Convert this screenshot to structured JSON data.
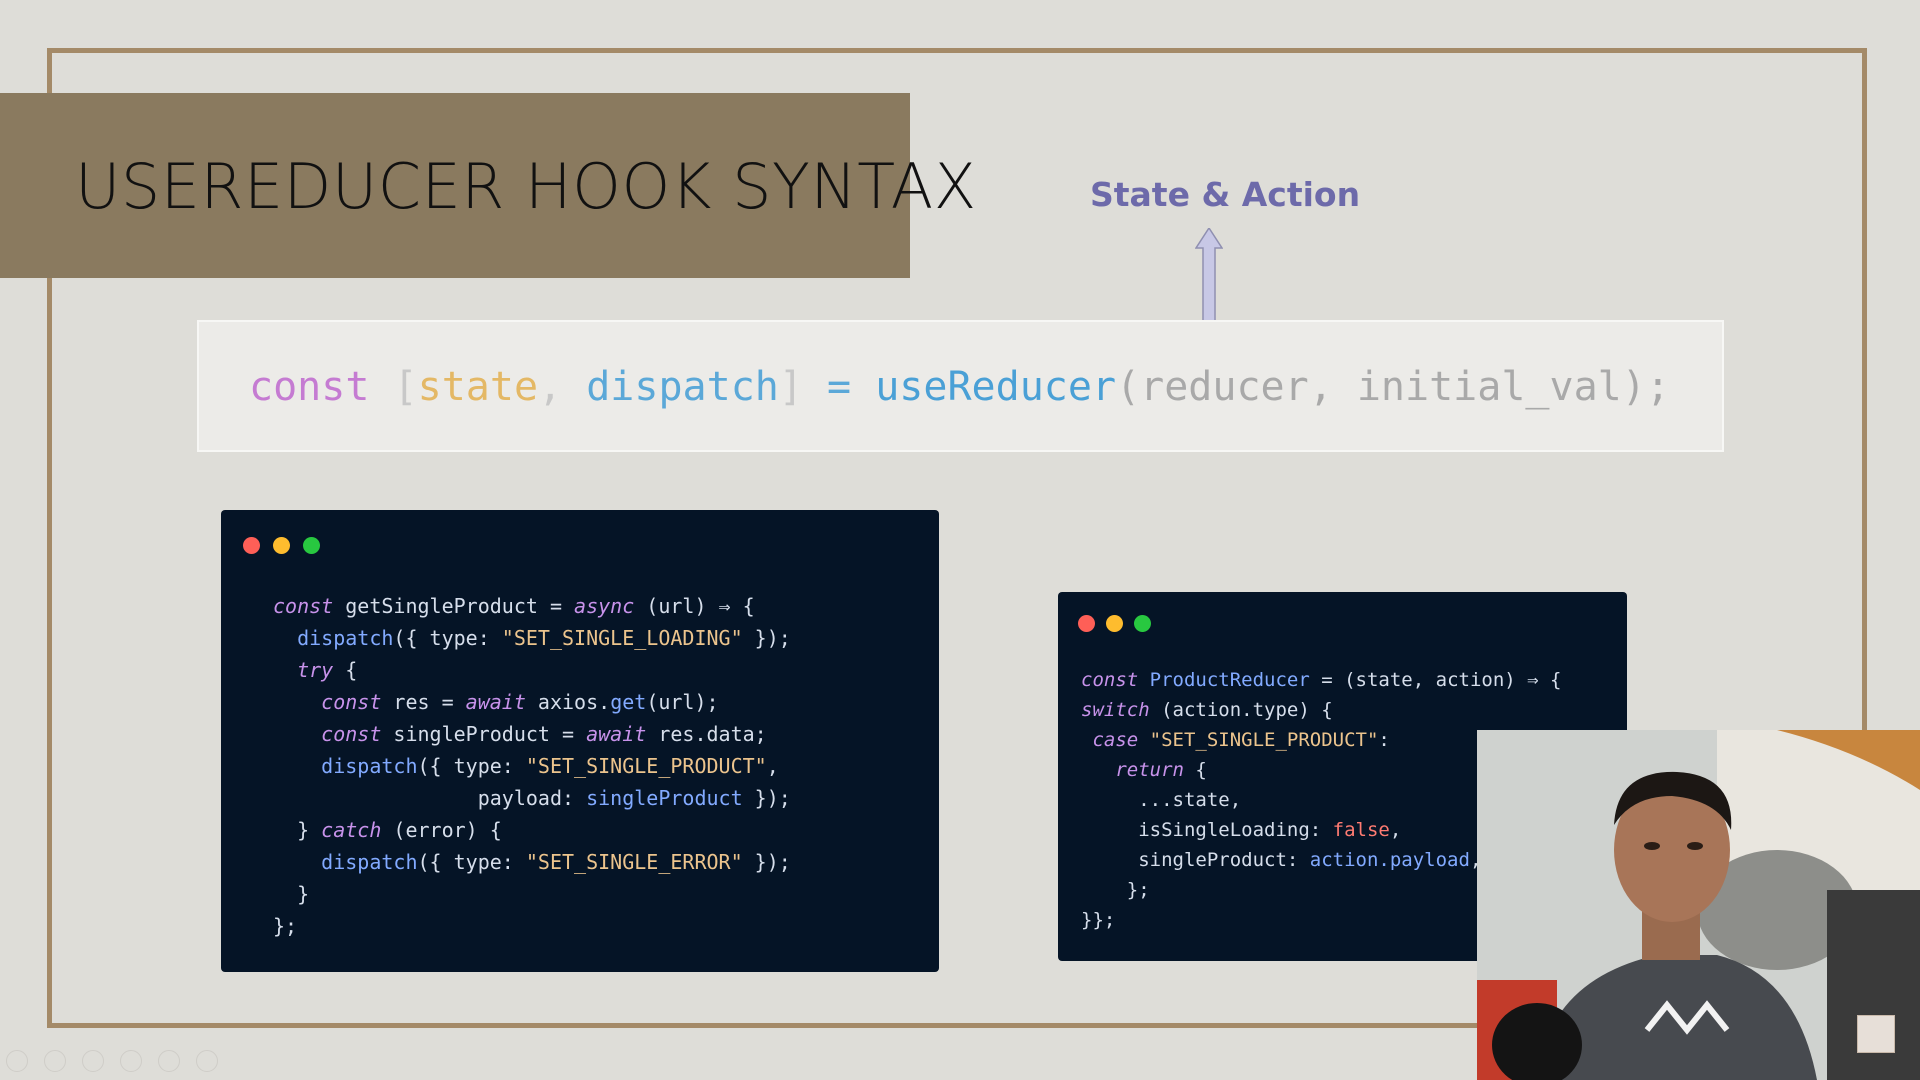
{
  "slide": {
    "title": "USEREDUCER HOOK SYNTAX",
    "annotation": "State & Action",
    "syntax": {
      "kw": "const",
      "open": "[",
      "state": "state",
      "comma1": ", ",
      "dispatch": "dispatch",
      "close": "]",
      "eq": " = ",
      "fn": "useReducer",
      "args": "(reducer, initial_val);"
    },
    "colors": {
      "frame": "#a48a68",
      "banner": "#8a7a5f",
      "annotation": "#6d6aaa",
      "code_bg": "#051426"
    }
  },
  "code_left": {
    "l1_const": "const",
    "l1_name": " getSingleProduct = ",
    "l1_async": "async",
    "l1_rest": " (url) ⇒ {",
    "l2_fn": "  dispatch",
    "l2_a": "({ type: ",
    "l2_str": "\"SET_SINGLE_LOADING\"",
    "l2_b": " });",
    "l3_try": "  try",
    "l3_b": " {",
    "l4_const": "    const",
    "l4_a": " res = ",
    "l4_await": "await",
    "l4_b": " axios.",
    "l4_get": "get",
    "l4_c": "(url);",
    "l5_const": "    const",
    "l5_a": " singleProduct = ",
    "l5_await": "await",
    "l5_b": " res.data;",
    "l6_fn": "    dispatch",
    "l6_a": "({ type: ",
    "l6_str": "\"SET_SINGLE_PRODUCT\"",
    "l6_b": ",",
    "l7_a": "                 payload: ",
    "l7_val": "singleProduct",
    "l7_b": " });",
    "l8_a": "  } ",
    "l8_catch": "catch",
    "l8_b": " (error) {",
    "l9_fn": "    dispatch",
    "l9_a": "({ type: ",
    "l9_str": "\"SET_SINGLE_ERROR\"",
    "l9_b": " });",
    "l10": "  }",
    "l11": "};"
  },
  "code_right": {
    "l1_const": "const",
    "l1_name": " ProductReducer",
    "l1_a": " = (state, action) ⇒ {",
    "l2_switch": "switch",
    "l2_a": " (action.type) {",
    "l3_case": " case",
    "l3_str": " \"SET_SINGLE_PRODUCT\"",
    "l3_a": ":",
    "l4_return": "   return",
    "l4_a": " {",
    "l5": "     ...state,",
    "l6_a": "     isSingleLoading: ",
    "l6_false": "false",
    "l6_b": ",",
    "l7_a": "     singleProduct: ",
    "l7_val": "action.payload",
    "l7_b": ",",
    "l8": "    };",
    "l9": "}};"
  }
}
